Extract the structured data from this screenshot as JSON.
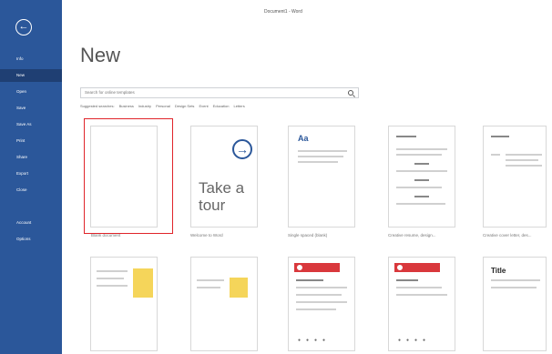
{
  "window": {
    "title": "Document1 - Word"
  },
  "sidebar": {
    "back_icon": "back-arrow-icon",
    "items": [
      {
        "label": "Info"
      },
      {
        "label": "New"
      },
      {
        "label": "Open"
      },
      {
        "label": "Save"
      },
      {
        "label": "Save As"
      },
      {
        "label": "Print"
      },
      {
        "label": "Share"
      },
      {
        "label": "Export"
      },
      {
        "label": "Close"
      },
      {
        "label": "Account"
      },
      {
        "label": "Options"
      }
    ],
    "active_index": 1,
    "color": "#2b579a"
  },
  "main": {
    "title": "New",
    "search": {
      "placeholder": "Search for online templates"
    },
    "suggested": [
      "Suggested searches:",
      "Business",
      "Industry",
      "Personal",
      "Design Sets",
      "Event",
      "Education",
      "Letters"
    ],
    "templates": [
      {
        "label": "Blank document"
      },
      {
        "label": "Welcome to Word",
        "tour_line1": "Take a",
        "tour_line2": "tour"
      },
      {
        "label": "Single spaced (blank)",
        "sample": "Aa"
      },
      {
        "label": "Creative resume, design..."
      },
      {
        "label": "Creative cover letter, des..."
      },
      {
        "label": ""
      },
      {
        "label": ""
      },
      {
        "label": ""
      },
      {
        "label": ""
      },
      {
        "label": "",
        "heading": "Title"
      }
    ],
    "selected_template": 0,
    "highlight_color": "#e0242a"
  }
}
